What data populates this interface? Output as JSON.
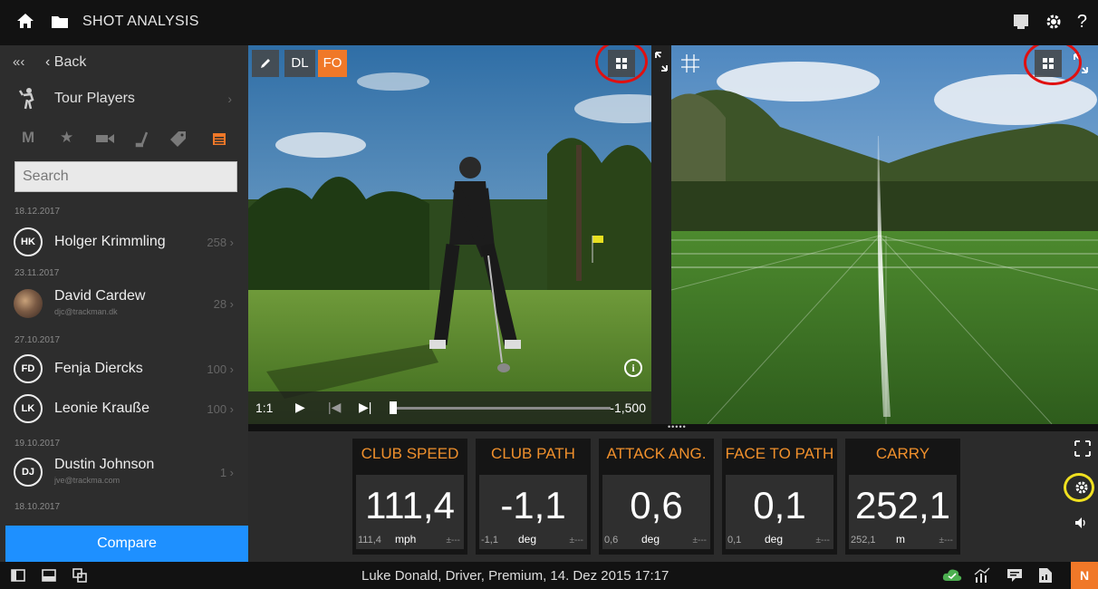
{
  "topbar": {
    "title": "SHOT ANALYSIS",
    "icons": [
      "home-icon",
      "folder-icon",
      "presentation-icon",
      "gear-icon",
      "help-icon"
    ],
    "help_label": "?"
  },
  "sidebar": {
    "collapse_label": "«‹",
    "back_label": "‹ Back",
    "tour_players_label": "Tour Players",
    "filter_m": "M",
    "search_placeholder": "Search",
    "groups": [
      {
        "date": "18.12.2017",
        "players": [
          {
            "initials": "HK",
            "name": "Holger Krimmling",
            "count": "258 ›"
          }
        ]
      },
      {
        "date": "23.11.2017",
        "players": [
          {
            "name": "David Cardew",
            "email": "djc@trackman.dk",
            "count": "28 ›"
          }
        ]
      },
      {
        "date": "27.10.2017",
        "players": [
          {
            "initials": "FD",
            "name": "Fenja Diercks",
            "count": "100 ›"
          },
          {
            "initials": "LK",
            "name": "Leonie Krauße",
            "count": "100 ›"
          }
        ]
      },
      {
        "date": "19.10.2017",
        "players": [
          {
            "initials": "DJ",
            "name": "Dustin Johnson",
            "email": "jve@trackma.com",
            "count": "1 ›"
          }
        ]
      },
      {
        "date": "18.10.2017",
        "players": []
      }
    ],
    "compare_label": "Compare"
  },
  "video": {
    "dl_label": "DL",
    "fo_label": "FO",
    "ratio": "1:1",
    "time": "-1,500",
    "info_label": "i"
  },
  "metrics": [
    {
      "header": "CLUB SPEED",
      "value": "111,4",
      "sub": "111,4",
      "unit": "mph",
      "tol": "±---"
    },
    {
      "header": "CLUB PATH",
      "value": "-1,1",
      "sub": "-1,1",
      "unit": "deg",
      "tol": "±---"
    },
    {
      "header": "ATTACK ANG.",
      "value": "0,6",
      "sub": "0,6",
      "unit": "deg",
      "tol": "±---"
    },
    {
      "header": "FACE TO PATH",
      "value": "0,1",
      "sub": "0,1",
      "unit": "deg",
      "tol": "±---"
    },
    {
      "header": "CARRY",
      "value": "252,1",
      "sub": "252,1",
      "unit": "m",
      "tol": "±---"
    }
  ],
  "statusbar": {
    "shot_info": "Luke Donald, Driver, Premium, 14. Dez 2015 17:17",
    "badge": "N"
  },
  "colors": {
    "accent": "#f07828",
    "compare": "#1e90ff",
    "metric_header": "#f0902c",
    "annotation_red": "#e01010",
    "annotation_yellow": "#f0e020"
  }
}
